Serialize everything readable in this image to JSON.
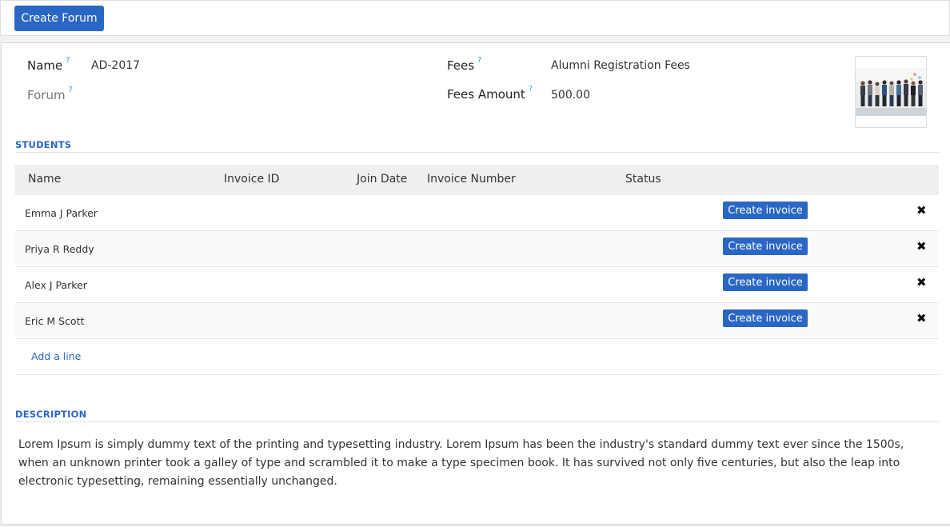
{
  "toolbar": {
    "create_forum_label": "Create Forum"
  },
  "form": {
    "name_label": "Name",
    "name_value": "AD-2017",
    "forum_label": "Forum",
    "fees_label": "Fees",
    "fees_value": "Alumni Registration Fees",
    "fees_amount_label": "Fees Amount",
    "fees_amount_value": "500.00",
    "help_mark": "?"
  },
  "students": {
    "title": "STUDENTS",
    "columns": [
      "Name",
      "Invoice ID",
      "Join Date",
      "Invoice Number",
      "Status"
    ],
    "rows": [
      {
        "name": "Emma J Parker",
        "action": "Create invoice"
      },
      {
        "name": "Priya R Reddy",
        "action": "Create invoice"
      },
      {
        "name": "Alex J Parker",
        "action": "Create invoice"
      },
      {
        "name": "Eric M Scott",
        "action": "Create invoice"
      }
    ],
    "add_line": "Add a line",
    "delete_glyph": "✖"
  },
  "description": {
    "title": "DESCRIPTION",
    "text": "Lorem Ipsum is simply dummy text of the printing and typesetting industry. Lorem Ipsum has been the industry's standard dummy text ever since the 1500s, when an unknown printer took a galley of type and scrambled it to make a type specimen book. It has survived not only five centuries, but also the leap into electronic typesetting, remaining essentially unchanged."
  },
  "colors": {
    "primary": "#2a67c4",
    "help": "#2aa5c9"
  }
}
